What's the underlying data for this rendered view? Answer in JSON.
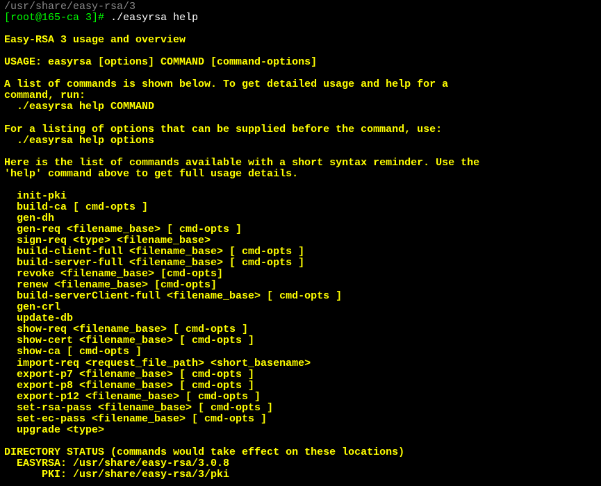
{
  "truncated_line": "/usr/share/easy-rsa/3",
  "prompt": {
    "user": "[root@165-ca 3]",
    "hash": "#",
    "command": "./easyrsa help"
  },
  "title": "Easy-RSA 3 usage and overview",
  "usage_line": "USAGE: easyrsa [options] COMMAND [command-options]",
  "desc1_line1": "A list of commands is shown below. To get detailed usage and help for a",
  "desc1_line2": "command, run:",
  "desc1_line3": "  ./easyrsa help COMMAND",
  "desc2_line1": "For a listing of options that can be supplied before the command, use:",
  "desc2_line2": "  ./easyrsa help options",
  "desc3_line1": "Here is the list of commands available with a short syntax reminder. Use the",
  "desc3_line2": "'help' command above to get full usage details.",
  "commands": {
    "c1": "  init-pki",
    "c2": "  build-ca [ cmd-opts ]",
    "c3": "  gen-dh",
    "c4": "  gen-req <filename_base> [ cmd-opts ]",
    "c5": "  sign-req <type> <filename_base>",
    "c6": "  build-client-full <filename_base> [ cmd-opts ]",
    "c7": "  build-server-full <filename_base> [ cmd-opts ]",
    "c8": "  revoke <filename_base> [cmd-opts]",
    "c9": "  renew <filename_base> [cmd-opts]",
    "c10": "  build-serverClient-full <filename_base> [ cmd-opts ]",
    "c11": "  gen-crl",
    "c12": "  update-db",
    "c13": "  show-req <filename_base> [ cmd-opts ]",
    "c14": "  show-cert <filename_base> [ cmd-opts ]",
    "c15": "  show-ca [ cmd-opts ]",
    "c16": "  import-req <request_file_path> <short_basename>",
    "c17": "  export-p7 <filename_base> [ cmd-opts ]",
    "c18": "  export-p8 <filename_base> [ cmd-opts ]",
    "c19": "  export-p12 <filename_base> [ cmd-opts ]",
    "c20": "  set-rsa-pass <filename_base> [ cmd-opts ]",
    "c21": "  set-ec-pass <filename_base> [ cmd-opts ]",
    "c22": "  upgrade <type>"
  },
  "dir_status_header": "DIRECTORY STATUS (commands would take effect on these locations)",
  "dir_status_line1": "  EASYRSA: /usr/share/easy-rsa/3.0.8",
  "dir_status_line2": "      PKI: /usr/share/easy-rsa/3/pki"
}
